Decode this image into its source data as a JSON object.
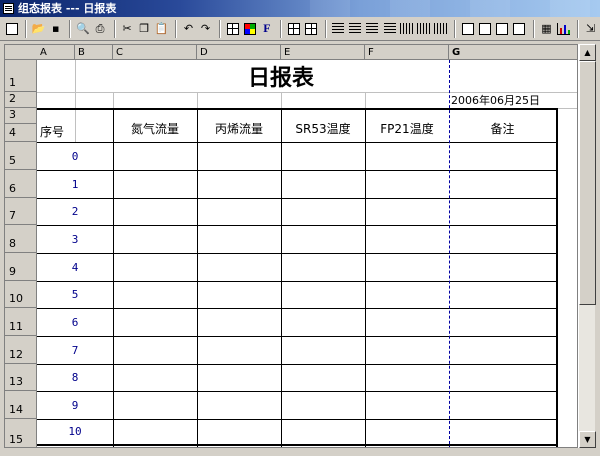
{
  "window": {
    "title": "组态报表 --- 日报表"
  },
  "toolbar": {
    "icons": [
      "new-icon",
      "open-icon",
      "save-icon",
      "print-preview-icon",
      "print-icon",
      "cut-icon",
      "copy-icon",
      "paste-icon",
      "undo-icon",
      "redo-icon",
      "grid-icon",
      "color-icon",
      "font-icon",
      "insert-row-icon",
      "insert-col-icon",
      "border-icon",
      "align-left-icon",
      "align-center-icon",
      "align-right-icon",
      "bars-icon",
      "bars2-icon",
      "bars3-icon",
      "merge-icon",
      "split-icon",
      "split2-icon",
      "split3-icon",
      "image-icon",
      "chart-icon",
      "exit-icon"
    ],
    "font_label": "F"
  },
  "sheet": {
    "col_headers": [
      "A",
      "B",
      "C",
      "D",
      "E",
      "F",
      "G"
    ],
    "row_headers": [
      "1",
      "2",
      "3",
      "4",
      "5",
      "6",
      "7",
      "8",
      "9",
      "10",
      "11",
      "12",
      "13",
      "14",
      "15"
    ],
    "report_title": "日报表",
    "report_date": "2006年06月25日",
    "seq_header": "序号",
    "columns": [
      "氮气流量",
      "丙烯流量",
      "SR53温度",
      "FP21温度",
      "备注"
    ],
    "seq_values": [
      "0",
      "1",
      "2",
      "3",
      "4",
      "5",
      "6",
      "7",
      "8",
      "9",
      "10"
    ]
  },
  "colors": {
    "titlebar_start": "#0a246a",
    "number_text": "#00008b",
    "page_break": "#0000a0"
  }
}
